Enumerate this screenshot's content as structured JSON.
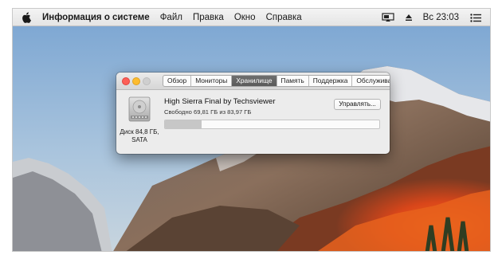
{
  "menubar": {
    "app_name": "Информация о системе",
    "items": [
      "Файл",
      "Правка",
      "Окно",
      "Справка"
    ],
    "clock": "Вс 23:03"
  },
  "window": {
    "tabs": [
      {
        "label": "Обзор",
        "active": false
      },
      {
        "label": "Мониторы",
        "active": false
      },
      {
        "label": "Хранилище",
        "active": true
      },
      {
        "label": "Память",
        "active": false
      },
      {
        "label": "Поддержка",
        "active": false
      },
      {
        "label": "Обслуживание",
        "active": false
      }
    ],
    "disk": {
      "label_line1": "Диск 84,8 ГБ,",
      "label_line2": "SATA"
    },
    "volume": {
      "name": "High Sierra Final by Techsviewer",
      "free": "Свободно 69,81 ГБ из 83,97 ГБ",
      "used_fraction": 0.17
    },
    "manage_button": "Управлять..."
  },
  "colors": {
    "active_tab": "#5f5f5f",
    "close": "#fc5f57",
    "minimize": "#fdbc2e",
    "storage_used": "#c7c7c7"
  },
  "icons": [
    "apple-icon",
    "airplay-icon",
    "eject-icon",
    "list-icon",
    "hard-disk-icon"
  ]
}
